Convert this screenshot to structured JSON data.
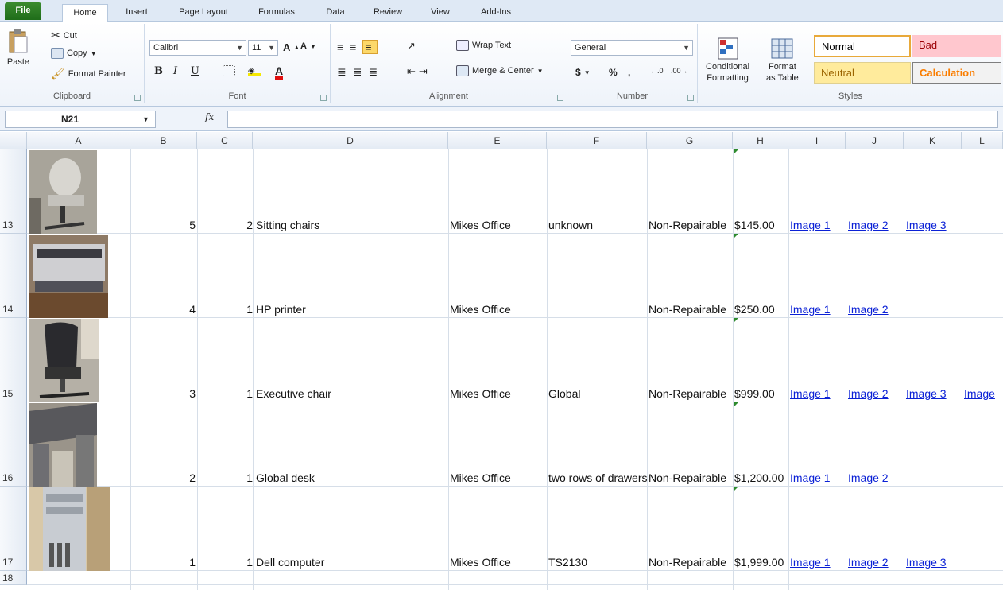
{
  "tabs": [
    "File",
    "Home",
    "Insert",
    "Page Layout",
    "Formulas",
    "Data",
    "Review",
    "View",
    "Add-Ins"
  ],
  "clipboard": {
    "paste": "Paste",
    "cut": "Cut",
    "copy": "Copy",
    "format_painter": "Format Painter",
    "label": "Clipboard"
  },
  "font": {
    "name": "Calibri",
    "size": "11",
    "bold": "B",
    "italic": "I",
    "underline": "U",
    "label": "Font"
  },
  "alignment": {
    "wrap_text": "Wrap Text",
    "merge_center": "Merge & Center",
    "label": "Alignment"
  },
  "number": {
    "format": "General",
    "currency": "$",
    "percent": "%",
    "comma": ",",
    "label": "Number"
  },
  "styles": {
    "conditional": "Conditional\nFormatting",
    "conditional_l1": "Conditional",
    "conditional_l2": "Formatting",
    "format_table_l1": "Format",
    "format_table_l2": "as Table",
    "normal": "Normal",
    "bad": "Bad",
    "neutral": "Neutral",
    "calculation": "Calculation",
    "label": "Styles"
  },
  "formula_bar": {
    "name_box": "N21",
    "fx": "fx",
    "formula": ""
  },
  "columns": [
    "A",
    "B",
    "C",
    "D",
    "E",
    "F",
    "G",
    "H",
    "I",
    "J",
    "K",
    "L"
  ],
  "rows": [
    {
      "num": "13",
      "b": "5",
      "c": "2",
      "d": "Sitting chairs",
      "e": "Mikes Office",
      "f": "unknown",
      "g": "Non-Repairable",
      "h": "$145.00",
      "links": [
        "Image 1",
        "Image 2",
        "Image 3"
      ]
    },
    {
      "num": "14",
      "b": "4",
      "c": "1",
      "d": "HP printer",
      "e": "Mikes Office",
      "f": "",
      "g": "Non-Repairable",
      "h": "$250.00",
      "links": [
        "Image 1",
        "Image 2"
      ]
    },
    {
      "num": "15",
      "b": "3",
      "c": "1",
      "d": "Executive chair",
      "e": "Mikes Office",
      "f": "Global",
      "g": "Non-Repairable",
      "h": "$999.00",
      "links": [
        "Image 1",
        "Image 2",
        "Image 3",
        "Image"
      ]
    },
    {
      "num": "16",
      "b": "2",
      "c": "1",
      "d": "Global desk",
      "e": "Mikes Office",
      "f": "two rows of drawers",
      "g": "Non-Repairable",
      "h": "$1,200.00",
      "links": [
        "Image 1",
        "Image 2"
      ]
    },
    {
      "num": "17",
      "b": "1",
      "c": "1",
      "d": "Dell computer",
      "e": "Mikes Office",
      "f": "TS2130",
      "g": "Non-Repairable",
      "h": "$1,999.00",
      "links": [
        "Image 1",
        "Image 2",
        "Image 3"
      ]
    }
  ],
  "last_row": "18"
}
